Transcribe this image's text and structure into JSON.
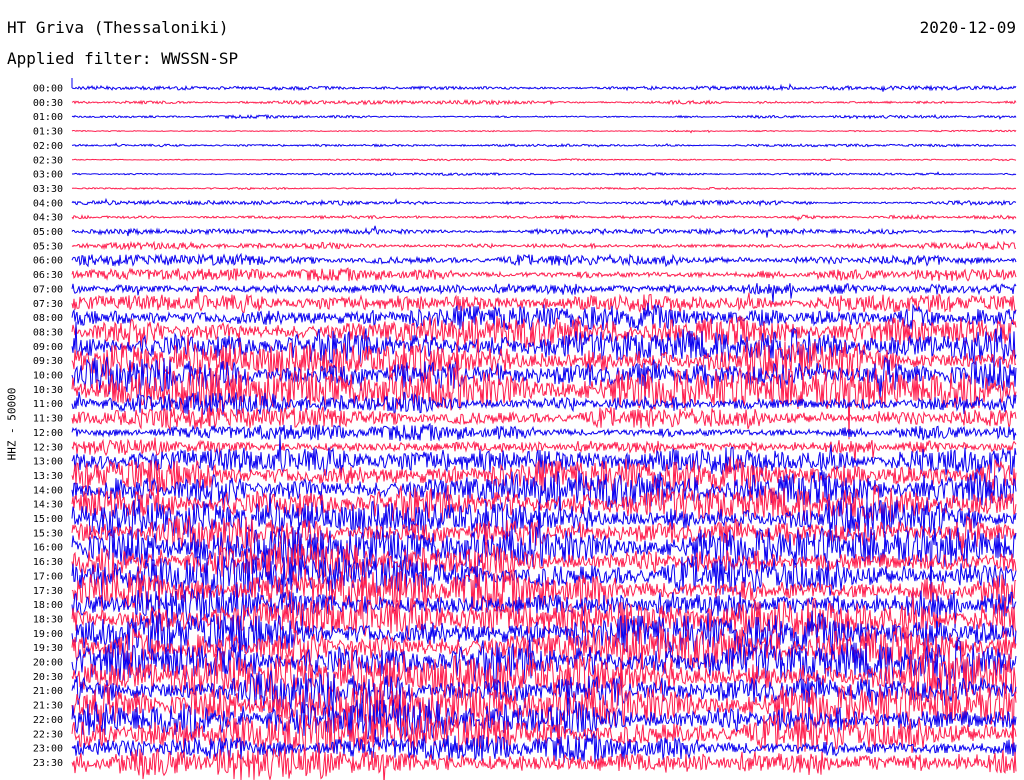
{
  "header": {
    "station": "HT Griva (Thessaloniki)",
    "date": "2020-12-09",
    "filter": "Applied filter: WWSSN-SP"
  },
  "axis": {
    "ylabel": "HHZ - 50000"
  },
  "colors": {
    "trace_a": "#0a00f0",
    "trace_b": "#ff1f4f",
    "text": "#000000"
  },
  "chart_data": {
    "type": "line",
    "title": "HT Griva (Thessaloniki)",
    "subtitle": "Applied filter: WWSSN-SP",
    "ylabel": "HHZ - 50000",
    "xlabel": "",
    "grid": false,
    "rows": [
      "00:00",
      "00:30",
      "01:00",
      "01:30",
      "02:00",
      "02:30",
      "03:00",
      "03:30",
      "04:00",
      "04:30",
      "05:00",
      "05:30",
      "06:00",
      "06:30",
      "07:00",
      "07:30",
      "08:00",
      "08:30",
      "09:00",
      "09:30",
      "10:00",
      "10:30",
      "11:00",
      "11:30",
      "12:00",
      "12:30",
      "13:00",
      "13:30",
      "14:00",
      "14:30",
      "15:00",
      "15:30",
      "16:00",
      "16:30",
      "17:00",
      "17:30",
      "18:00",
      "18:30",
      "19:00",
      "19:30",
      "20:00",
      "20:30",
      "21:00",
      "21:30",
      "22:00",
      "22:30",
      "23:00",
      "23:30"
    ],
    "series": [
      {
        "color": "#0a00f0",
        "rows": "even"
      },
      {
        "color": "#ff1f4f",
        "rows": "odd"
      }
    ],
    "relative_amplitude": [
      0.3,
      0.3,
      0.25,
      0.15,
      0.2,
      0.15,
      0.2,
      0.15,
      0.35,
      0.35,
      0.4,
      0.55,
      0.9,
      1.0,
      1.3,
      1.4,
      2.2,
      2.5,
      2.8,
      3.0,
      3.2,
      3.3,
      1.8,
      1.7,
      1.3,
      1.5,
      2.2,
      2.8,
      3.0,
      3.0,
      2.9,
      3.0,
      3.1,
      3.0,
      3.1,
      3.2,
      3.2,
      3.3,
      3.4,
      3.4,
      3.5,
      3.5,
      3.5,
      3.3,
      3.3,
      3.0,
      2.2,
      2.8
    ]
  }
}
